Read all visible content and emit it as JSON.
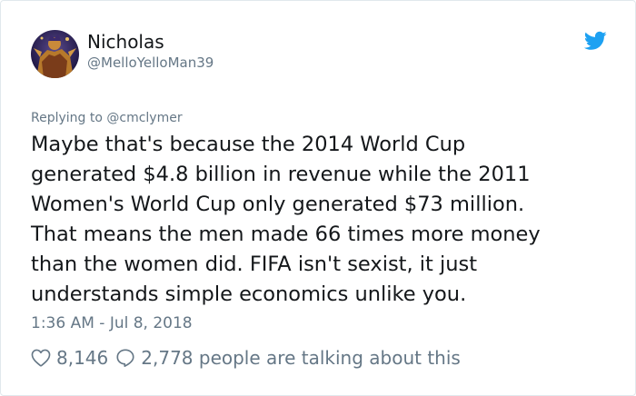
{
  "user": {
    "display_name": "Nicholas",
    "handle": "@MelloYelloMan39"
  },
  "tweet": {
    "replying_to": "Replying to @cmclymer",
    "text": "Maybe that's because the 2014 World Cup\ngenerated $4.8 billion in revenue while the 2011\nWomen's World Cup only generated $73 million.\nThat means the men made 66 times more money\nthan the women did. FIFA isn't sexist, it just\nunderstands simple economics unlike you.",
    "timestamp": "1:36 AM - Jul 8, 2018",
    "likes": "8,146",
    "talking": "2,778 people are talking about this"
  },
  "icons": {
    "brand": "twitter-bird-icon",
    "like": "heart-icon",
    "reply": "speech-bubble-icon"
  },
  "colors": {
    "brand": "#1da1f2",
    "text": "#14171a",
    "secondary": "#657786",
    "border": "#e1e8ed"
  }
}
